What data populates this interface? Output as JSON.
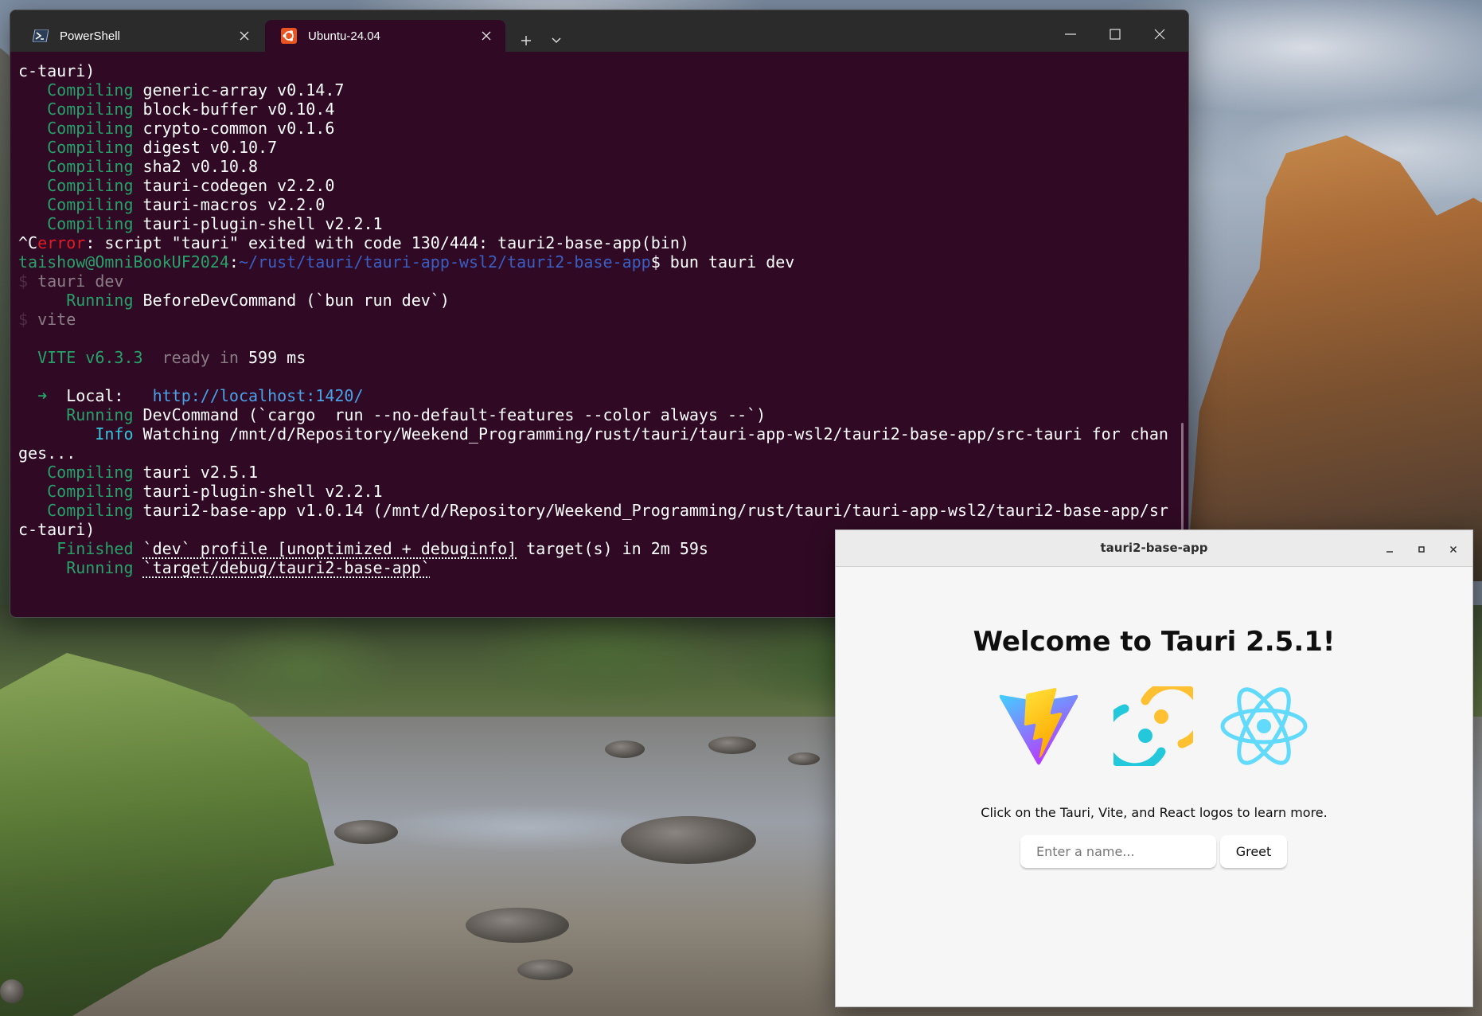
{
  "terminal": {
    "tabs": [
      {
        "label": "PowerShell",
        "icon": "powershell-icon",
        "active": false
      },
      {
        "label": "Ubuntu-24.04",
        "icon": "ubuntu-icon",
        "active": true
      }
    ],
    "lines": [
      [
        {
          "t": "c-tauri)"
        }
      ],
      [
        {
          "t": "   Compiling",
          "c": "g"
        },
        {
          "t": " generic-array v0.14.7"
        }
      ],
      [
        {
          "t": "   Compiling",
          "c": "g"
        },
        {
          "t": " block-buffer v0.10.4"
        }
      ],
      [
        {
          "t": "   Compiling",
          "c": "g"
        },
        {
          "t": " crypto-common v0.1.6"
        }
      ],
      [
        {
          "t": "   Compiling",
          "c": "g"
        },
        {
          "t": " digest v0.10.7"
        }
      ],
      [
        {
          "t": "   Compiling",
          "c": "g"
        },
        {
          "t": " sha2 v0.10.8"
        }
      ],
      [
        {
          "t": "   Compiling",
          "c": "g"
        },
        {
          "t": " tauri-codegen v2.2.0"
        }
      ],
      [
        {
          "t": "   Compiling",
          "c": "g"
        },
        {
          "t": " tauri-macros v2.2.0"
        }
      ],
      [
        {
          "t": "   Compiling",
          "c": "g"
        },
        {
          "t": " tauri-plugin-shell v2.2.1"
        }
      ],
      [
        {
          "t": "^C"
        },
        {
          "t": "error",
          "c": "r"
        },
        {
          "t": ": script \"tauri\" exited with code 130/444: tauri2-base-app(bin)"
        }
      ],
      [
        {
          "t": "taishow@OmniBookUF2024",
          "c": "g"
        },
        {
          "t": ":"
        },
        {
          "t": "~/rust/tauri/tauri-app-wsl2/tauri2-base-app",
          "c": "b"
        },
        {
          "t": "$ bun tauri dev"
        }
      ],
      [
        {
          "t": "$",
          "c": "pu"
        },
        {
          "t": " tauri dev",
          "c": "d"
        }
      ],
      [
        {
          "t": "     Running",
          "c": "g"
        },
        {
          "t": " BeforeDevCommand (`bun run dev`)"
        }
      ],
      [
        {
          "t": "$",
          "c": "pu"
        },
        {
          "t": " vite",
          "c": "d"
        }
      ],
      [
        {
          "t": ""
        }
      ],
      [
        {
          "t": "  VITE v6.3.3",
          "c": "g"
        },
        {
          "t": "  ready in ",
          "c": "d"
        },
        {
          "t": "599"
        },
        {
          "t": " ms"
        }
      ],
      [
        {
          "t": ""
        }
      ],
      [
        {
          "t": "  ➜",
          "c": "g"
        },
        {
          "t": "  Local:   "
        },
        {
          "t": "http://localhost:1420/",
          "c": "lk"
        }
      ],
      [
        {
          "t": "     Running",
          "c": "g"
        },
        {
          "t": " DevCommand (`cargo  run --no-default-features --color always --`)"
        }
      ],
      [
        {
          "t": "        Info",
          "c": "cy"
        },
        {
          "t": " Watching /mnt/d/Repository/Weekend_Programming/rust/tauri/tauri-app-wsl2/tauri2-base-app/src-tauri for chan"
        }
      ],
      [
        {
          "t": "ges..."
        }
      ],
      [
        {
          "t": "   Compiling",
          "c": "g"
        },
        {
          "t": " tauri v2.5.1"
        }
      ],
      [
        {
          "t": "   Compiling",
          "c": "g"
        },
        {
          "t": " tauri-plugin-shell v2.2.1"
        }
      ],
      [
        {
          "t": "   Compiling",
          "c": "g"
        },
        {
          "t": " tauri2-base-app v1.0.14 (/mnt/d/Repository/Weekend_Programming/rust/tauri/tauri-app-wsl2/tauri2-base-app/sr"
        }
      ],
      [
        {
          "t": "c-tauri)"
        }
      ],
      [
        {
          "t": "    Finished",
          "c": "g"
        },
        {
          "t": " "
        },
        {
          "t": "`dev` profile [unoptimized + debuginfo]",
          "c": "u"
        },
        {
          "t": " target(s) in 2m 59s"
        }
      ],
      [
        {
          "t": "     Running",
          "c": "g"
        },
        {
          "t": " "
        },
        {
          "t": "`target/debug/tauri2-base-app`",
          "c": "u"
        }
      ]
    ]
  },
  "app": {
    "title": "tauri2-base-app",
    "heading": "Welcome to Tauri 2.5.1!",
    "logos": [
      "vite-logo-icon",
      "tauri-logo-icon",
      "react-logo-icon"
    ],
    "hint": "Click on the Tauri, Vite, and React logos to learn more.",
    "name_placeholder": "Enter a name...",
    "name_value": "",
    "greet_label": "Greet"
  },
  "colors": {
    "terminal_bg": "#300a24",
    "tab_strip_bg": "#2b2b2b",
    "ansi_green": "#26a269",
    "ansi_red": "#e01b24",
    "ansi_blue": "#3a5fc4",
    "ansi_cyan": "#33c7de",
    "link": "#4aa1e8",
    "app_bg": "#f6f6f6",
    "react": "#61dafb",
    "tauri": "#ffc131",
    "tauri_secondary": "#24c8db"
  }
}
